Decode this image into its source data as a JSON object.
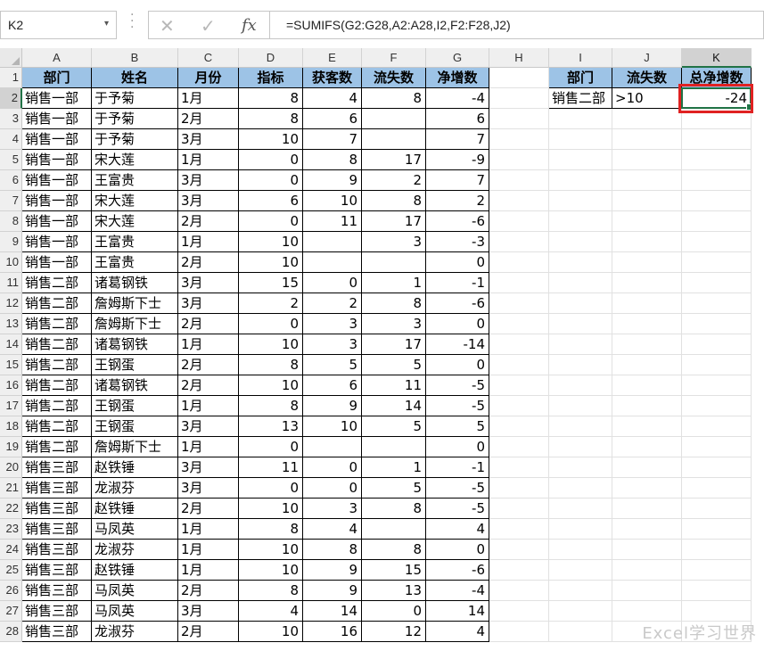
{
  "formula_bar": {
    "name_box": "K2",
    "name_arrow": "▾",
    "cancel_icon": "✕",
    "enter_icon": "✓",
    "fx_label": "fx",
    "formula": "=SUMIFS(G2:G28,A2:A28,I2,F2:F28,J2)"
  },
  "columns": [
    "A",
    "B",
    "C",
    "D",
    "E",
    "F",
    "G",
    "H",
    "I",
    "J",
    "K"
  ],
  "selected_column": "K",
  "selected_row": "2",
  "main_table": {
    "headers": [
      "部门",
      "姓名",
      "月份",
      "指标",
      "获客数",
      "流失数",
      "净增数"
    ],
    "rows": [
      [
        "销售一部",
        "于予菊",
        "1月",
        "8",
        "4",
        "8",
        "-4"
      ],
      [
        "销售一部",
        "于予菊",
        "2月",
        "8",
        "6",
        "",
        "6"
      ],
      [
        "销售一部",
        "于予菊",
        "3月",
        "10",
        "7",
        "",
        "7"
      ],
      [
        "销售一部",
        "宋大莲",
        "1月",
        "0",
        "8",
        "17",
        "-9"
      ],
      [
        "销售一部",
        "王富贵",
        "3月",
        "0",
        "9",
        "2",
        "7"
      ],
      [
        "销售一部",
        "宋大莲",
        "3月",
        "6",
        "10",
        "8",
        "2"
      ],
      [
        "销售一部",
        "宋大莲",
        "2月",
        "0",
        "11",
        "17",
        "-6"
      ],
      [
        "销售一部",
        "王富贵",
        "1月",
        "10",
        "",
        "3",
        "-3"
      ],
      [
        "销售一部",
        "王富贵",
        "2月",
        "10",
        "",
        "",
        "0"
      ],
      [
        "销售二部",
        "诸葛钢铁",
        "3月",
        "15",
        "0",
        "1",
        "-1"
      ],
      [
        "销售二部",
        "詹姆斯下士",
        "3月",
        "2",
        "2",
        "8",
        "-6"
      ],
      [
        "销售二部",
        "詹姆斯下士",
        "2月",
        "0",
        "3",
        "3",
        "0"
      ],
      [
        "销售二部",
        "诸葛钢铁",
        "1月",
        "10",
        "3",
        "17",
        "-14"
      ],
      [
        "销售二部",
        "王钢蛋",
        "2月",
        "8",
        "5",
        "5",
        "0"
      ],
      [
        "销售二部",
        "诸葛钢铁",
        "2月",
        "10",
        "6",
        "11",
        "-5"
      ],
      [
        "销售二部",
        "王钢蛋",
        "1月",
        "8",
        "9",
        "14",
        "-5"
      ],
      [
        "销售二部",
        "王钢蛋",
        "3月",
        "13",
        "10",
        "5",
        "5"
      ],
      [
        "销售二部",
        "詹姆斯下士",
        "1月",
        "0",
        "",
        "",
        "0"
      ],
      [
        "销售三部",
        "赵铁锤",
        "3月",
        "11",
        "0",
        "1",
        "-1"
      ],
      [
        "销售三部",
        "龙淑芬",
        "3月",
        "0",
        "0",
        "5",
        "-5"
      ],
      [
        "销售三部",
        "赵铁锤",
        "2月",
        "10",
        "3",
        "8",
        "-5"
      ],
      [
        "销售三部",
        "马凤英",
        "1月",
        "8",
        "4",
        "",
        "4"
      ],
      [
        "销售三部",
        "龙淑芬",
        "1月",
        "10",
        "8",
        "8",
        "0"
      ],
      [
        "销售三部",
        "赵铁锤",
        "1月",
        "10",
        "9",
        "15",
        "-6"
      ],
      [
        "销售三部",
        "马凤英",
        "2月",
        "8",
        "9",
        "13",
        "-4"
      ],
      [
        "销售三部",
        "马凤英",
        "3月",
        "4",
        "14",
        "0",
        "14"
      ],
      [
        "销售三部",
        "龙淑芬",
        "2月",
        "10",
        "16",
        "12",
        "4"
      ]
    ]
  },
  "criteria_table": {
    "headers": [
      "部门",
      "流失数",
      "总净增数"
    ],
    "row": [
      "销售二部",
      ">10",
      "-24"
    ]
  },
  "watermark": "Excel学习世界",
  "colors": {
    "header_fill": "#9dc3e6",
    "selection": "#217346",
    "highlight": "#e02222"
  }
}
